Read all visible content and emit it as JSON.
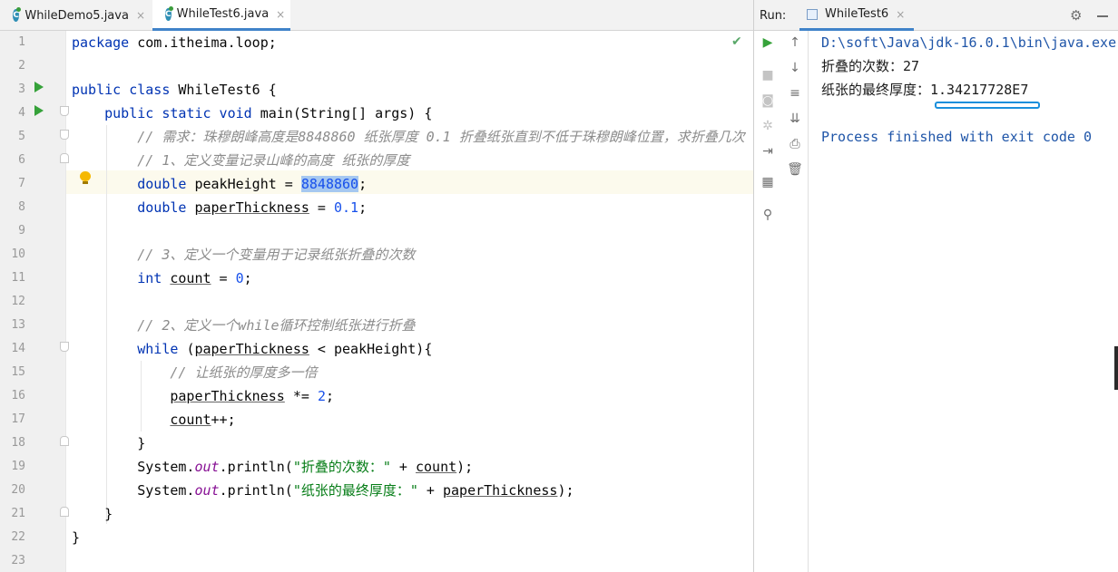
{
  "editor": {
    "tabs": [
      {
        "label": "WhileDemo5.java",
        "icon": "java-class-icon",
        "close": "×"
      },
      {
        "label": "WhileTest6.java",
        "icon": "java-class-icon",
        "close": "×"
      }
    ],
    "inspection_icon": "check-icon",
    "lines": [
      {
        "n": "1",
        "parts": [
          {
            "t": "package ",
            "c": "kw"
          },
          {
            "t": "com.itheima.loop;",
            "c": ""
          }
        ]
      },
      {
        "n": "2",
        "parts": []
      },
      {
        "n": "3",
        "parts": [
          {
            "t": "public class ",
            "c": "kw"
          },
          {
            "t": "WhileTest6 {",
            "c": ""
          }
        ]
      },
      {
        "n": "4",
        "parts": [
          {
            "t": "    public static void ",
            "c": "kw"
          },
          {
            "t": "main(String[] args) {",
            "c": ""
          }
        ]
      },
      {
        "n": "5",
        "parts": [
          {
            "t": "        // 需求：珠穆朗峰高度是8848860 纸张厚度 0.1 折叠纸张直到不低于珠穆朗峰位置，求折叠几次",
            "c": "cmt"
          }
        ]
      },
      {
        "n": "6",
        "parts": [
          {
            "t": "        // 1、定义变量记录山峰的高度 纸张的厚度",
            "c": "cmt"
          }
        ]
      },
      {
        "n": "7",
        "parts": [
          {
            "t": "        double ",
            "c": "kw"
          },
          {
            "t": "peakHeight = ",
            "c": ""
          },
          {
            "t": "8848860",
            "c": "num sel"
          },
          {
            "t": ";",
            "c": ""
          }
        ]
      },
      {
        "n": "8",
        "parts": [
          {
            "t": "        double ",
            "c": "kw"
          },
          {
            "t": "paperThickness",
            "c": "ul"
          },
          {
            "t": " = ",
            "c": ""
          },
          {
            "t": "0.1",
            "c": "num"
          },
          {
            "t": ";",
            "c": ""
          }
        ]
      },
      {
        "n": "9",
        "parts": []
      },
      {
        "n": "10",
        "parts": [
          {
            "t": "        // 3、定义一个变量用于记录纸张折叠的次数",
            "c": "cmt"
          }
        ]
      },
      {
        "n": "11",
        "parts": [
          {
            "t": "        int ",
            "c": "kw"
          },
          {
            "t": "count",
            "c": "ul"
          },
          {
            "t": " = ",
            "c": ""
          },
          {
            "t": "0",
            "c": "num"
          },
          {
            "t": ";",
            "c": ""
          }
        ]
      },
      {
        "n": "12",
        "parts": []
      },
      {
        "n": "13",
        "parts": [
          {
            "t": "        // 2、定义一个while循环控制纸张进行折叠",
            "c": "cmt"
          }
        ]
      },
      {
        "n": "14",
        "parts": [
          {
            "t": "        while ",
            "c": "kw"
          },
          {
            "t": "(",
            "c": ""
          },
          {
            "t": "paperThickness",
            "c": "ul"
          },
          {
            "t": " < peakHeight){",
            "c": ""
          }
        ]
      },
      {
        "n": "15",
        "parts": [
          {
            "t": "            // 让纸张的厚度多一倍",
            "c": "cmt"
          }
        ]
      },
      {
        "n": "16",
        "parts": [
          {
            "t": "            ",
            "c": ""
          },
          {
            "t": "paperThickness",
            "c": "ul"
          },
          {
            "t": " *= ",
            "c": ""
          },
          {
            "t": "2",
            "c": "num"
          },
          {
            "t": ";",
            "c": ""
          }
        ]
      },
      {
        "n": "17",
        "parts": [
          {
            "t": "            ",
            "c": ""
          },
          {
            "t": "count",
            "c": "ul"
          },
          {
            "t": "++;",
            "c": ""
          }
        ]
      },
      {
        "n": "18",
        "parts": [
          {
            "t": "        }",
            "c": ""
          }
        ]
      },
      {
        "n": "19",
        "parts": [
          {
            "t": "        System.",
            "c": ""
          },
          {
            "t": "out",
            "c": "fld"
          },
          {
            "t": ".println(",
            "c": ""
          },
          {
            "t": "\"折叠的次数：\"",
            "c": "str"
          },
          {
            "t": " + ",
            "c": ""
          },
          {
            "t": "count",
            "c": "ul"
          },
          {
            "t": ");",
            "c": ""
          }
        ]
      },
      {
        "n": "20",
        "parts": [
          {
            "t": "        System.",
            "c": ""
          },
          {
            "t": "out",
            "c": "fld"
          },
          {
            "t": ".println(",
            "c": ""
          },
          {
            "t": "\"纸张的最终厚度：\"",
            "c": "str"
          },
          {
            "t": " + ",
            "c": ""
          },
          {
            "t": "paperThickness",
            "c": "ul"
          },
          {
            "t": ");",
            "c": ""
          }
        ]
      },
      {
        "n": "21",
        "parts": [
          {
            "t": "    }",
            "c": ""
          }
        ]
      },
      {
        "n": "22",
        "parts": [
          {
            "t": "}",
            "c": ""
          }
        ]
      },
      {
        "n": "23",
        "parts": []
      }
    ]
  },
  "run_panel": {
    "label": "Run:",
    "tab_label": "WhileTest6",
    "tab_close": "×",
    "settings_icon": "gear-icon",
    "console": [
      {
        "text": "D:\\soft\\Java\\jdk-16.0.1\\bin\\java.exe",
        "kind": "path"
      },
      {
        "text": "折叠的次数：27",
        "kind": "out"
      },
      {
        "text": "纸张的最终厚度：1.34217728E7",
        "kind": "out"
      },
      {
        "text": "",
        "kind": "out"
      },
      {
        "text": "Process finished with exit code 0",
        "kind": "exit"
      }
    ]
  },
  "colors": {
    "keyword": "#0033b3",
    "number": "#1750eb",
    "string": "#067d17",
    "comment": "#8c8c8c",
    "field": "#871094",
    "run_green": "#36a23a",
    "highlight_blue": "#1a8fdc"
  }
}
